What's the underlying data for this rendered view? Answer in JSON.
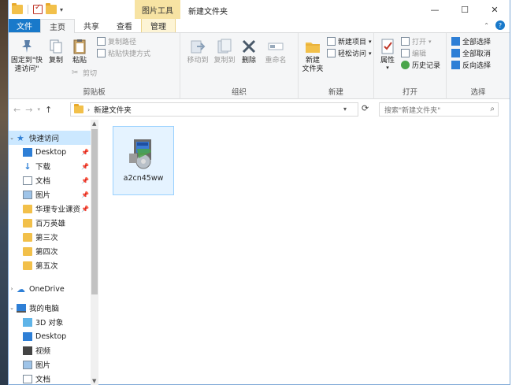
{
  "titlebar": {
    "tools_tab": "图片工具",
    "title": "新建文件夹",
    "minimize": "—",
    "maximize": "☐",
    "close": "✕"
  },
  "tabs": {
    "file": "文件",
    "home": "主页",
    "share": "共享",
    "view": "查看",
    "manage": "管理"
  },
  "ribbon": {
    "clipboard": {
      "label": "剪贴板",
      "pin": "固定到\"快\n速访问\"",
      "copy": "复制",
      "paste": "粘贴",
      "copy_path": "复制路径",
      "paste_shortcut": "粘贴快捷方式",
      "cut": "剪切"
    },
    "organize": {
      "label": "组织",
      "move_to": "移动到",
      "copy_to": "复制到",
      "delete": "删除",
      "rename": "重命名"
    },
    "new": {
      "label": "新建",
      "new_folder": "新建\n文件夹",
      "new_item": "新建项目",
      "easy_access": "轻松访问"
    },
    "open": {
      "label": "打开",
      "properties": "属性",
      "open": "打开",
      "edit": "编辑",
      "history": "历史记录"
    },
    "select": {
      "label": "选择",
      "select_all": "全部选择",
      "select_none": "全部取消",
      "invert": "反向选择"
    }
  },
  "address": {
    "path": "新建文件夹",
    "search_placeholder": "搜索\"新建文件夹\""
  },
  "nav": {
    "quick_access": "快速访问",
    "items": [
      {
        "label": "Desktop",
        "icon": "desktop"
      },
      {
        "label": "下载",
        "icon": "download"
      },
      {
        "label": "文档",
        "icon": "doc"
      },
      {
        "label": "图片",
        "icon": "pictures"
      },
      {
        "label": "华理专业课资",
        "icon": "folder"
      },
      {
        "label": "百万英雄",
        "icon": "folder"
      },
      {
        "label": "第三次",
        "icon": "folder"
      },
      {
        "label": "第四次",
        "icon": "folder"
      },
      {
        "label": "第五次",
        "icon": "folder"
      }
    ],
    "onedrive": "OneDrive",
    "this_pc": "我的电脑",
    "pc_items": [
      {
        "label": "3D 对象"
      },
      {
        "label": "Desktop"
      },
      {
        "label": "视频"
      },
      {
        "label": "图片"
      },
      {
        "label": "文档"
      }
    ]
  },
  "files": [
    {
      "name": "a2cn45ww",
      "icon": "installer-icon"
    }
  ]
}
